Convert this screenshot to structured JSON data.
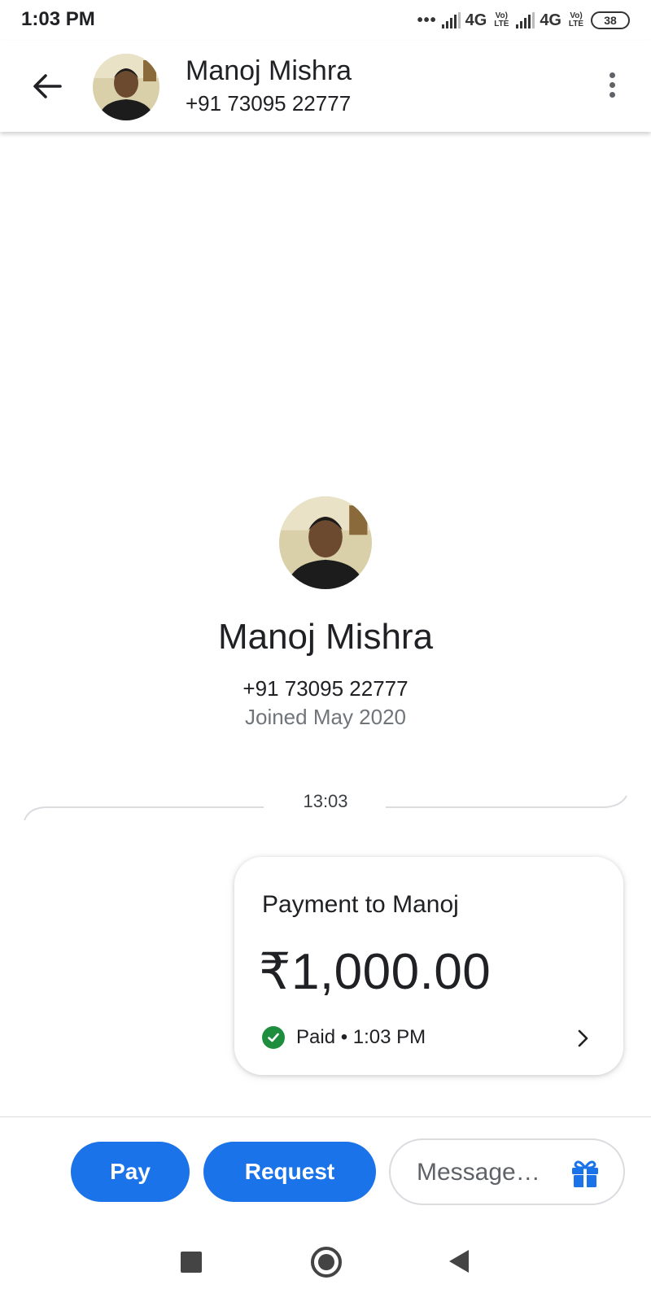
{
  "status_bar": {
    "time": "1:03 PM",
    "dots": "•••",
    "network_1": "4G",
    "volte_1": "Vo) LTE",
    "network_2": "4G",
    "volte_2": "Vo) LTE",
    "battery": "38"
  },
  "header": {
    "back_icon": "arrow-left-icon",
    "contact_name": "Manoj Mishra",
    "contact_phone": "+91 73095 22777",
    "more_icon": "more-vert-icon"
  },
  "profile": {
    "name": "Manoj Mishra",
    "phone": "+91 73095 22777",
    "joined": "Joined May 2020"
  },
  "timeline": {
    "timestamp": "13:03"
  },
  "payment_card": {
    "title": "Payment to Manoj",
    "amount": "₹1,000.00",
    "status": "Paid • 1:03 PM",
    "status_icon": "check-circle-icon",
    "status_color": "#1e8e3e",
    "chevron_icon": "chevron-right-icon"
  },
  "actions": {
    "pay_label": "Pay",
    "request_label": "Request",
    "message_placeholder": "Message…",
    "gift_icon": "gift-icon",
    "accent_color": "#1a73e8"
  },
  "nav_bar": {
    "recents_icon": "square-icon",
    "home_icon": "home-circle-icon",
    "back_icon": "triangle-back-icon"
  }
}
